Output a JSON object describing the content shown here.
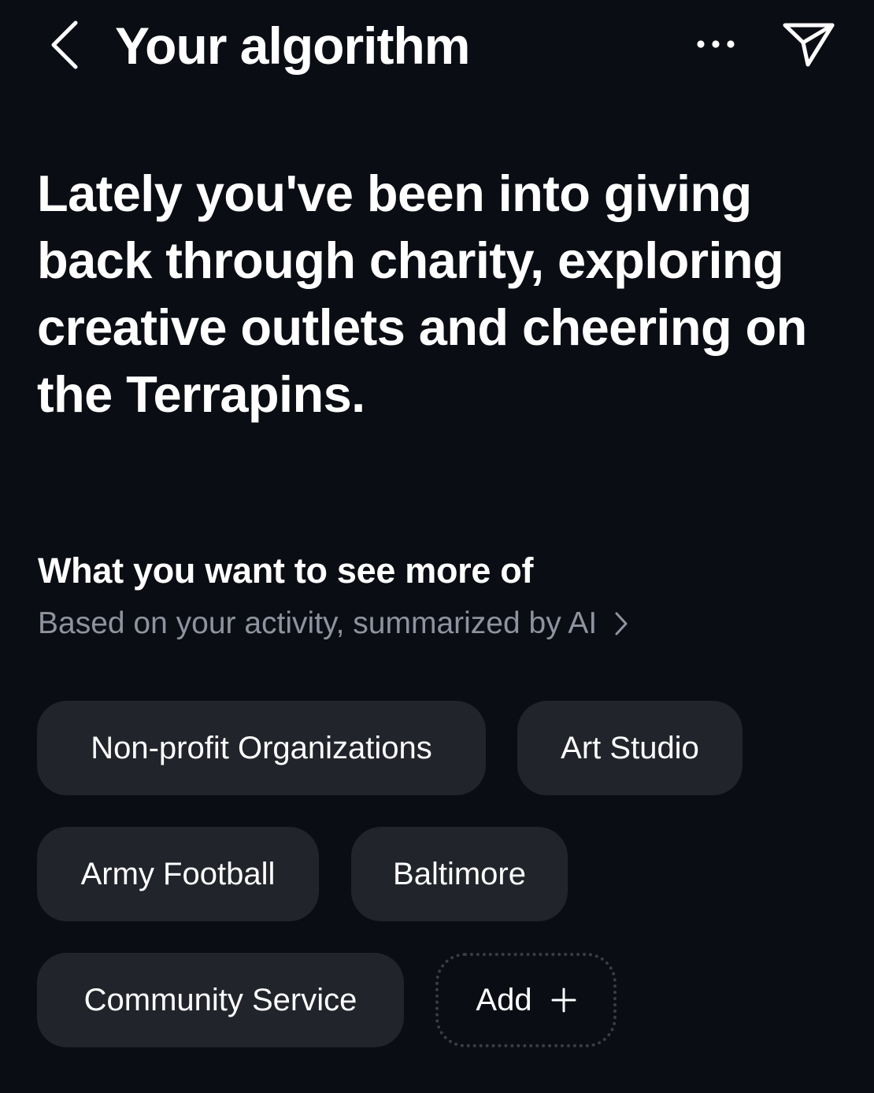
{
  "header": {
    "title": "Your algorithm",
    "back_icon": "chevron-left-icon",
    "more_icon": "more-horizontal-icon",
    "share_icon": "send-paper-plane-icon"
  },
  "summary": {
    "text": "Lately you've been into giving back through charity, exploring creative outlets and cheering on the Terrapins."
  },
  "interests": {
    "title": "What you want to see more of",
    "subtitle": "Based on your activity, summarized by AI",
    "chips": [
      {
        "label": "Non-profit Organizations"
      },
      {
        "label": "Art Studio"
      },
      {
        "label": "Army Football"
      },
      {
        "label": "Baltimore"
      },
      {
        "label": "Community Service"
      }
    ],
    "add_label": "Add"
  },
  "colors": {
    "background": "#0b0d14",
    "chip_background": "#22242b",
    "muted_text": "#8e939f",
    "add_border": "#3a3d47"
  }
}
